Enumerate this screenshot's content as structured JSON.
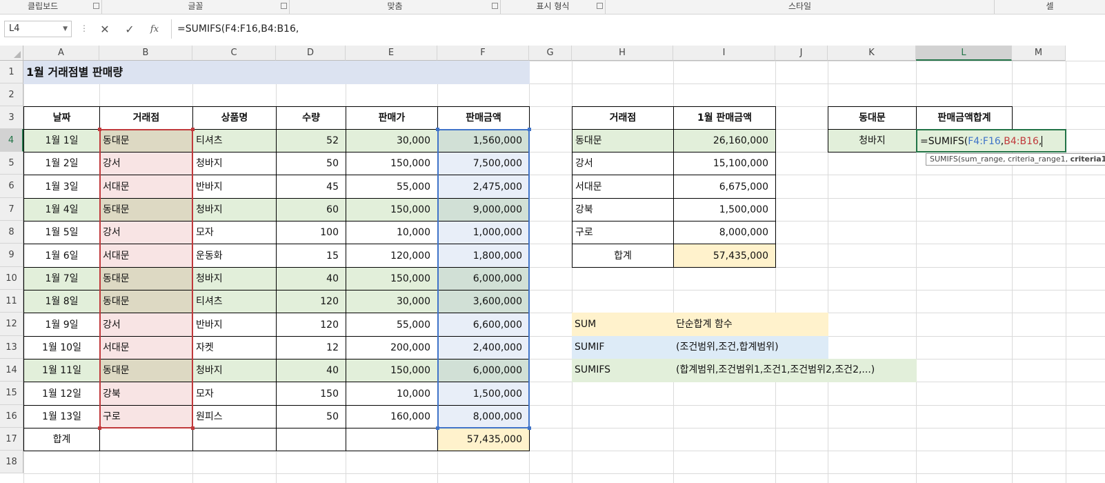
{
  "ribbon": {
    "groups": [
      "클립보드",
      "글꼴",
      "맞춤",
      "표시 형식",
      "스타일",
      "셀"
    ]
  },
  "formula_bar": {
    "name_box": "L4",
    "cancel_icon": "✕",
    "enter_icon": "✓",
    "fx_label": "fx",
    "formula": "=SUMIFS(F4:F16,B4:B16,"
  },
  "columns": [
    "A",
    "B",
    "C",
    "D",
    "E",
    "F",
    "G",
    "H",
    "I",
    "J",
    "K",
    "L",
    "M"
  ],
  "rows": [
    "1",
    "2",
    "3",
    "4",
    "5",
    "6",
    "7",
    "8",
    "9",
    "10",
    "11",
    "12",
    "13",
    "14",
    "15",
    "16",
    "17",
    "18"
  ],
  "title": "1월 거래점별 판매량",
  "main_table": {
    "headers": [
      "날짜",
      "거래점",
      "상품명",
      "수량",
      "판매가",
      "판매금액"
    ],
    "rows": [
      [
        "1월 1일",
        "동대문",
        "티셔츠",
        "52",
        "30,000",
        "1,560,000"
      ],
      [
        "1월 2일",
        "강서",
        "청바지",
        "50",
        "150,000",
        "7,500,000"
      ],
      [
        "1월 3일",
        "서대문",
        "반바지",
        "45",
        "55,000",
        "2,475,000"
      ],
      [
        "1월 4일",
        "동대문",
        "청바지",
        "60",
        "150,000",
        "9,000,000"
      ],
      [
        "1월 5일",
        "강서",
        "모자",
        "100",
        "10,000",
        "1,000,000"
      ],
      [
        "1월 6일",
        "서대문",
        "운동화",
        "15",
        "120,000",
        "1,800,000"
      ],
      [
        "1월 7일",
        "동대문",
        "청바지",
        "40",
        "150,000",
        "6,000,000"
      ],
      [
        "1월 8일",
        "동대문",
        "티셔츠",
        "120",
        "30,000",
        "3,600,000"
      ],
      [
        "1월 9일",
        "강서",
        "반바지",
        "120",
        "55,000",
        "6,600,000"
      ],
      [
        "1월 10일",
        "서대문",
        "자켓",
        "12",
        "200,000",
        "2,400,000"
      ],
      [
        "1월 11일",
        "동대문",
        "청바지",
        "40",
        "150,000",
        "6,000,000"
      ],
      [
        "1월 12일",
        "강북",
        "모자",
        "150",
        "10,000",
        "1,500,000"
      ],
      [
        "1월 13일",
        "구로",
        "원피스",
        "50",
        "160,000",
        "8,000,000"
      ]
    ],
    "total_label": "합계",
    "total_value": "57,435,000"
  },
  "summary_table": {
    "headers": [
      "거래점",
      "1월 판매금액"
    ],
    "rows": [
      [
        "동대문",
        "26,160,000"
      ],
      [
        "강서",
        "15,100,000"
      ],
      [
        "서대문",
        "6,675,000"
      ],
      [
        "강북",
        "1,500,000"
      ],
      [
        "구로",
        "8,000,000"
      ]
    ],
    "total_label": "합계",
    "total_value": "57,435,000"
  },
  "criteria_table": {
    "headers": [
      "동대문",
      "판매금액합계"
    ],
    "row": [
      "청바지",
      "=SUMIFS(F4:F16,B4:B16,"
    ],
    "formula_parts": [
      "=SUMIFS(",
      "F4:F16",
      ",",
      "B4:B16",
      ","
    ]
  },
  "tooltip": {
    "signature": "SUMIFS(sum_range, criteria_range1, ",
    "current_arg": "criteria1"
  },
  "notes": [
    [
      "SUM",
      "단순합계 함수"
    ],
    [
      "SUMIF",
      "(조건범위,조건,합계범위)"
    ],
    [
      "SUMIFS",
      "(합계범위,조건범위1,조건1,조건범위2,조건2,...)"
    ]
  ],
  "colors": {
    "title_bg": "#dce3f1",
    "dongdaemun_row": "#e2efda",
    "store_col": "#f8e4e4",
    "store_col_dongdaemun": "#ddd9c3",
    "amount_col": "#e8eef8",
    "amount_col_dongdaemun": "#d1e0d6",
    "total_bg": "#fff2cc",
    "note_sum": "#fff2cc",
    "note_sumif": "#ddebf7",
    "note_sumifs": "#e2efda",
    "ref_blue": "#3f73c8",
    "ref_red": "#c0393b",
    "excel_green": "#217346"
  }
}
